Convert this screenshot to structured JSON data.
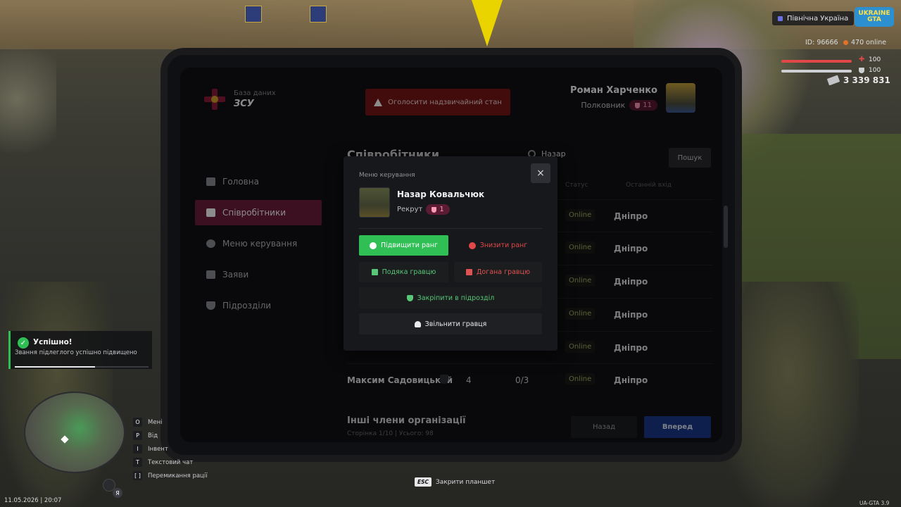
{
  "hud": {
    "server_name": "Північна Україна",
    "logo_text": "UKRAINE GTA",
    "player_id": "ID: 96666",
    "online": "470 online",
    "health": "100",
    "armor": "100",
    "money": "3 339 831",
    "datetime": "11.05.2026 | 20:07",
    "version": "UA-GTA 3.9",
    "close_hint_key": "ESC",
    "close_hint_label": "Закрити планшет",
    "mic_letter": "Я"
  },
  "hints": [
    {
      "key": "O",
      "label": "Мені"
    },
    {
      "key": "P",
      "label": "Від"
    },
    {
      "key": "I",
      "label": "Інвент"
    },
    {
      "key": "T",
      "label": "Текстовий чат"
    },
    {
      "key": "[ ]",
      "label": "Перемикання рації"
    }
  ],
  "notification": {
    "title": "Успішно!",
    "text": "Звання підлеглого успішно підвищено",
    "progress_fraction": 0.6
  },
  "tablet": {
    "brand_sub": "База даних",
    "brand_title": "ЗСУ",
    "emergency_button": "Оголосити надзвичайний стан",
    "user": {
      "name": "Роман Харченко",
      "rank": "Полковник",
      "rank_level": "11"
    },
    "sidebar": [
      {
        "label": "Головна",
        "icon": "home-icon"
      },
      {
        "label": "Співробітники",
        "icon": "users-icon",
        "active": true
      },
      {
        "label": "Меню керування",
        "icon": "gear-icon"
      },
      {
        "label": "Заяви",
        "icon": "folder-icon"
      },
      {
        "label": "Підрозділи",
        "icon": "shield-icon"
      }
    ],
    "section_title": "Співробітники",
    "search": {
      "value": "Назар",
      "button": "Пошук"
    },
    "columns": {
      "status": "Статус",
      "last_login": "Останній вхід"
    },
    "rows": [
      {
        "name": "",
        "rank": "",
        "warns": "",
        "status": "Online",
        "city": "Дніпро"
      },
      {
        "name": "",
        "rank": "",
        "warns": "",
        "status": "Online",
        "city": "Дніпро"
      },
      {
        "name": "",
        "rank": "",
        "warns": "",
        "status": "Online",
        "city": "Дніпро"
      },
      {
        "name": "",
        "rank": "",
        "warns": "",
        "status": "Online",
        "city": "Дніпро"
      },
      {
        "name": "",
        "rank": "",
        "warns": "",
        "status": "Online",
        "city": "Дніпро"
      },
      {
        "name": "Максим Садовицький",
        "rank": "4",
        "warns": "0/3",
        "status": "Online",
        "city": "Дніпро"
      }
    ],
    "others_title": "Інші члени організації",
    "others_sub": "Сторінка 1/10 | Усього: 98",
    "pagination": {
      "back": "Назад",
      "next": "Вперед"
    }
  },
  "modal": {
    "label": "Меню керування",
    "close": "×",
    "name": "Назар Ковальчюк",
    "rank": "Рекрут",
    "rank_level": "1",
    "buttons": {
      "promote": "Підвищити ранг",
      "demote": "Знизити ранг",
      "thanks": "Подяка гравцю",
      "reprimand": "Догана гравцю",
      "assign": "Закріпити в підрозділ",
      "fire": "Звільнити гравця"
    }
  },
  "colors": {
    "accent": "#6e1c3c",
    "success": "#2fbf55",
    "danger": "#e14848",
    "primary": "#1c3a8c"
  }
}
